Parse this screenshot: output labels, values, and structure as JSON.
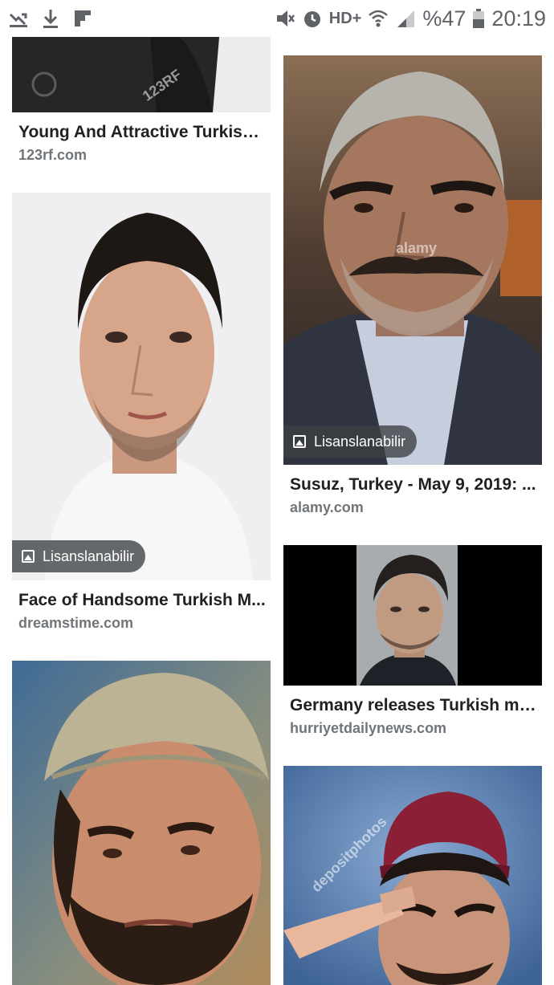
{
  "status_bar": {
    "battery": "%47",
    "time": "20:19",
    "network": "HD+"
  },
  "results": {
    "left": [
      {
        "title": "Young And Attractive Turkish ...",
        "domain": "123rf.com",
        "watermark": "123RF"
      },
      {
        "title": "Face of Handsome Turkish M...",
        "domain": "dreamstime.com",
        "badge": "Lisanslanabilir"
      },
      {
        "title": "",
        "domain": ""
      }
    ],
    "right": [
      {
        "title": "Susuz, Turkey - May 9, 2019: ...",
        "domain": "alamy.com",
        "badge": "Lisanslanabilir",
        "watermark": "alamy"
      },
      {
        "title": "Germany releases Turkish ma...",
        "domain": "hurriyetdailynews.com"
      },
      {
        "title": "",
        "domain": "",
        "watermark": "depositphotos"
      }
    ]
  },
  "colors": {
    "title_text": "#202124",
    "domain_text": "#70757a",
    "badge_bg": "rgba(60,64,67,0.78)"
  }
}
